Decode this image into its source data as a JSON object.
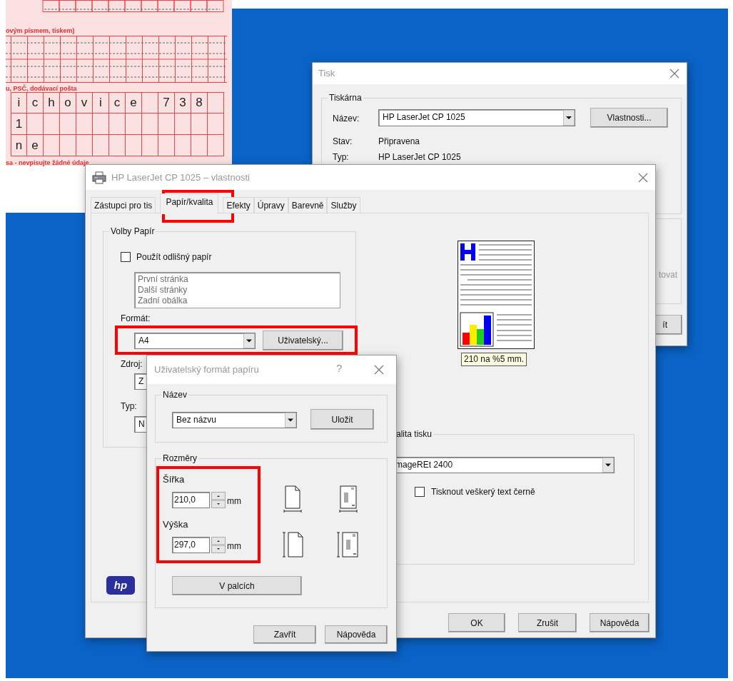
{
  "form": {
    "captions": [
      "ovým písmem, tiskem)",
      "u, PSČ, dodávací pošta",
      "sa - nevpisujte žádné údaje"
    ],
    "rows": [
      [
        [
          "i",
          "c",
          "h",
          "o",
          "v",
          "i",
          "c",
          "e"
        ],
        [
          "7",
          "3",
          "8"
        ]
      ],
      [
        [
          "1"
        ]
      ],
      [
        [
          "n",
          "e"
        ]
      ]
    ]
  },
  "print_window": {
    "title": "Tisk",
    "group": "Tiskárna",
    "name_label": "Název:",
    "name_value": "HP LaserJet CP 1025",
    "properties_button": "Vlastnosti...",
    "info": [
      {
        "label": "Stav:",
        "value": "Připravena"
      },
      {
        "label": "Typ:",
        "value": "HP LaserJet CP 1025"
      }
    ],
    "cut_text": "tovat",
    "cut_button": "ít"
  },
  "properties": {
    "title": "HP LaserJet CP 1025 – vlastnosti",
    "tabs": [
      {
        "label": "Zástupci pro tis",
        "selected": false
      },
      {
        "label": "Papír/kvalita",
        "selected": true
      },
      {
        "label": "Efekty",
        "selected": false
      },
      {
        "label": "Úpravy",
        "selected": false
      },
      {
        "label": "Barevně",
        "selected": false
      },
      {
        "label": "Služby",
        "selected": false
      }
    ],
    "paper_group": "Volby Papír",
    "different_paper": {
      "label": "Použít odlišný papír",
      "checked": false
    },
    "pages": [
      "První stránka",
      "Další stránky",
      "Zadní obálka"
    ],
    "format_label": "Formát:",
    "format_value": "A4",
    "custom_button": "Uživatelský...",
    "source_label": "Zdroj:",
    "source_value": "Z",
    "type_label": "Typ:",
    "type_value": "N",
    "preview_tooltip": "210 na %5 mm.",
    "quality_group": "alita tisku",
    "quality_value": "mageREt 2400",
    "black_text": {
      "label": "Tisknout veškerý text černě",
      "checked": false
    },
    "logo": "hp",
    "buttons": [
      "OK",
      "Zrušit",
      "Nápověda"
    ]
  },
  "dialog": {
    "title": "Uživatelský formát papíru",
    "help": "?",
    "name_group": "Název",
    "name_value": "Bez názvu",
    "save_button": "Uložit",
    "size_group": "Rozměry",
    "width_label": "Šířka",
    "width_value": "210,0",
    "height_label": "Výška",
    "height_value": "297,0",
    "width_unit": "mm",
    "height_unit": "mm",
    "inches_button": "V palcích",
    "buttons": [
      "Zavřít",
      "Nápověda"
    ]
  }
}
